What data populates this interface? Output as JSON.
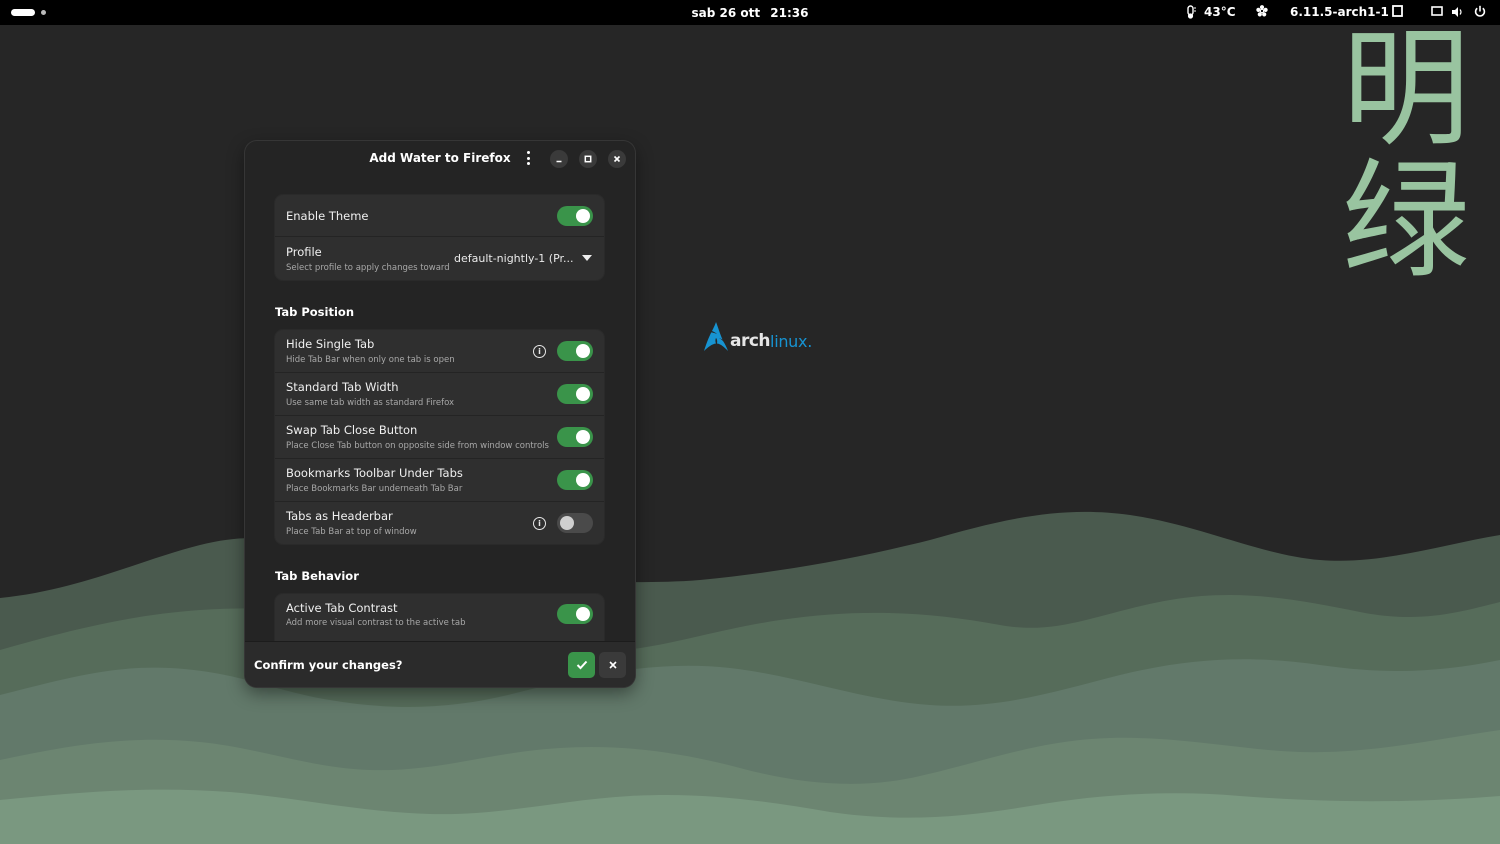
{
  "topbar": {
    "date": "sab 26 ott",
    "time": "21:36",
    "temperature": "43°C",
    "kernel": "6.11.5-arch1-1"
  },
  "desktop": {
    "wallpaper_chars": [
      "明",
      "绿"
    ],
    "logo_arch": "arch",
    "logo_linux": "linux."
  },
  "window": {
    "title": "Add Water to Firefox",
    "enable_theme_label": "Enable Theme",
    "enable_theme_on": true,
    "profile_label": "Profile",
    "profile_sub": "Select profile to apply changes toward",
    "profile_value": "default-nightly-1 (Pr...",
    "tab_position": {
      "heading": "Tab Position",
      "rows": [
        {
          "label": "Hide Single Tab",
          "sub": "Hide Tab Bar when only one tab is open",
          "on": true,
          "info": true
        },
        {
          "label": "Standard Tab Width",
          "sub": "Use same tab width as standard Firefox",
          "on": true,
          "info": false
        },
        {
          "label": "Swap Tab Close Button",
          "sub": "Place Close Tab button on opposite side from window controls",
          "on": true,
          "info": false
        },
        {
          "label": "Bookmarks Toolbar Under Tabs",
          "sub": "Place Bookmarks Bar underneath Tab Bar",
          "on": true,
          "info": false
        },
        {
          "label": "Tabs as Headerbar",
          "sub": "Place Tab Bar at top of window",
          "on": false,
          "info": true
        }
      ]
    },
    "tab_behavior": {
      "heading": "Tab Behavior",
      "rows": [
        {
          "label": "Active Tab Contrast",
          "sub": "Add more visual contrast to the active tab",
          "on": true
        }
      ]
    },
    "confirm_text": "Confirm your changes?"
  },
  "colors": {
    "accent_green": "#3a944a",
    "wallpaper_char_green": "#99c4a0",
    "arch_blue": "#1793d1"
  }
}
